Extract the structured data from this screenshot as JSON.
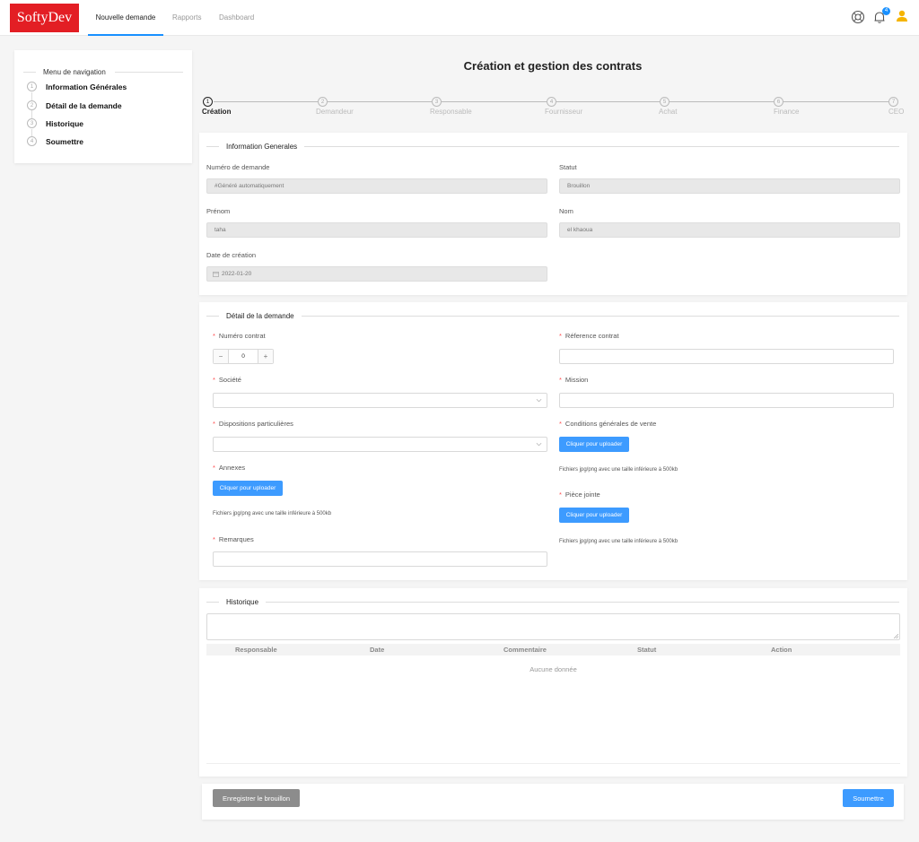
{
  "header": {
    "logo": "SoftyDev",
    "tabs": [
      {
        "label": "Nouvelle demande",
        "active": true
      },
      {
        "label": "Rapports",
        "active": false
      },
      {
        "label": "Dashboard",
        "active": false
      }
    ],
    "notification_count": "4",
    "icons": [
      "support-icon",
      "bell-icon",
      "user-icon"
    ]
  },
  "sidebar": {
    "title": "Menu de navigation",
    "items": [
      {
        "num": "1",
        "label": "Information Générales"
      },
      {
        "num": "2",
        "label": "Détail de la demande"
      },
      {
        "num": "3",
        "label": "Historique"
      },
      {
        "num": "4",
        "label": "Soumettre"
      }
    ]
  },
  "page_title": "Création et gestion des contrats",
  "steps": [
    {
      "num": "1",
      "label": "Création",
      "active": true
    },
    {
      "num": "2",
      "label": "Demandeur"
    },
    {
      "num": "3",
      "label": "Responsable"
    },
    {
      "num": "4",
      "label": "Fournisseur"
    },
    {
      "num": "5",
      "label": "Achat"
    },
    {
      "num": "6",
      "label": "Finance"
    },
    {
      "num": "7",
      "label": "CEO"
    }
  ],
  "info": {
    "title": "Information Generales",
    "numero_label": "Numéro de demande",
    "numero_value": "#Généré automatiquement",
    "statut_label": "Statut",
    "statut_value": "Brouillon",
    "prenom_label": "Prénom",
    "prenom_value": "taha",
    "nom_label": "Nom",
    "nom_value": "el khaoua",
    "date_label": "Date de création",
    "date_value": "2022-01-20"
  },
  "detail": {
    "title": "Détail de la demande",
    "numero_contrat_label": "Numéro contrat",
    "numero_contrat_value": "0",
    "stepper_minus": "−",
    "stepper_plus": "+",
    "reference_label": "Réference contrat",
    "societe_label": "Société",
    "mission_label": "Mission",
    "dispositions_label": "Dispositions particulières",
    "conditions_label": "Conditions générales de vente",
    "annexes_label": "Annexes",
    "piece_label": "Pièce jointe",
    "remarques_label": "Remarques",
    "upload_label": "Cliquer pour uploader",
    "upload_hint": "Fichiers jpg/png avec une taille inférieure à 500kb"
  },
  "historique": {
    "title": "Historique",
    "columns": [
      "Responsable",
      "Date",
      "Commentaire",
      "Statut",
      "Action"
    ],
    "empty": "Aucune donnée"
  },
  "footer": {
    "save_draft": "Enregistrer le brouillon",
    "submit": "Soumettre"
  },
  "colors": {
    "brand": "#e31e24",
    "accent": "#1890ff",
    "user_icon": "#f5b400"
  }
}
